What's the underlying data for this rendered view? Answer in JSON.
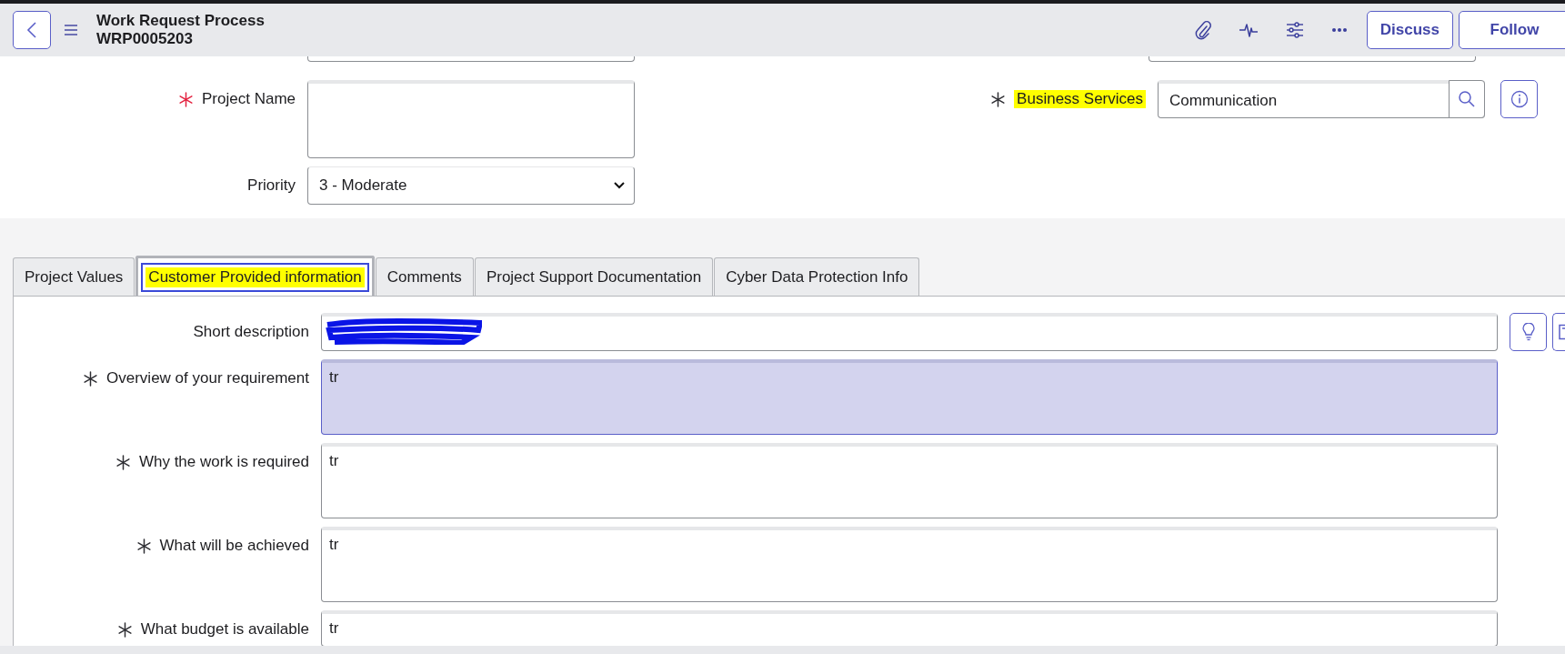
{
  "header": {
    "title": "Work Request Process",
    "number": "WRP0005203",
    "buttons": [
      {
        "label": "Discuss"
      },
      {
        "label": "Follow"
      }
    ]
  },
  "top_form": {
    "left": [
      {
        "label": "Project Name",
        "required": true,
        "filled": false,
        "highlighted": false,
        "kind": "textarea"
      },
      {
        "label": "Priority",
        "required": false,
        "highlighted": false,
        "kind": "select",
        "value": "3 - Moderate"
      }
    ],
    "right": [
      {
        "label": "Business Services",
        "required": true,
        "filled": true,
        "highlighted": true,
        "kind": "reference",
        "value": "Communication"
      }
    ]
  },
  "tabs": [
    {
      "label": "Project Values",
      "selected": false,
      "highlighted": false
    },
    {
      "label": "Customer Provided information",
      "selected": true,
      "highlighted": true
    },
    {
      "label": "Comments",
      "selected": false,
      "highlighted": false
    },
    {
      "label": "Project Support Documentation",
      "selected": false,
      "highlighted": false
    },
    {
      "label": "Cyber Data Protection Info",
      "selected": false,
      "highlighted": false
    }
  ],
  "tab_form": [
    {
      "label": "Short description",
      "required": false,
      "kind": "text",
      "redacted": true,
      "active": false
    },
    {
      "label": "Overview of your requirement",
      "required": true,
      "filled": true,
      "kind": "textarea",
      "value": "tr",
      "active": true
    },
    {
      "label": "Why the work is required",
      "required": true,
      "filled": true,
      "kind": "textarea",
      "value": "tr",
      "active": false
    },
    {
      "label": "What will be achieved",
      "required": true,
      "filled": true,
      "kind": "textarea",
      "value": "tr",
      "active": false
    },
    {
      "label": "What budget is available",
      "required": true,
      "filled": true,
      "kind": "textarea",
      "value": "tr",
      "active": false
    }
  ]
}
